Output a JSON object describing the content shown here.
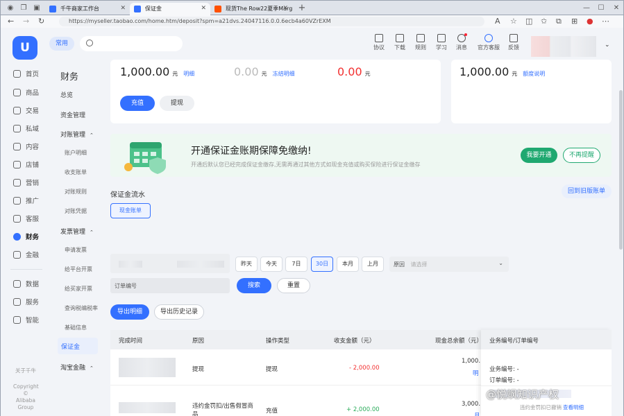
{
  "browser": {
    "tabs": [
      {
        "label": "千牛商家工作台",
        "active": false
      },
      {
        "label": "保证金",
        "active": true
      },
      {
        "label": "现货The Row22夏季Margaux...",
        "active": false
      }
    ],
    "url": "https://myseller.taobao.com/home.htm/deposit?spm=a21dvs.24047116.0.0.6ecb4a60VZrEXM"
  },
  "header": {
    "logo": "U",
    "common": "常用",
    "tools": [
      {
        "label": "协议",
        "icon": "doc-icon"
      },
      {
        "label": "下载",
        "icon": "download-icon"
      },
      {
        "label": "规则",
        "icon": "rule-icon"
      },
      {
        "label": "学习",
        "icon": "learn-icon"
      },
      {
        "label": "消息",
        "icon": "message-icon"
      },
      {
        "label": "官方客服",
        "icon": "service-icon"
      },
      {
        "label": "反馈",
        "icon": "feedback-icon"
      }
    ]
  },
  "sidebar": {
    "items": [
      {
        "label": "首页",
        "icon": "home-icon"
      },
      {
        "label": "商品",
        "icon": "goods-icon"
      },
      {
        "label": "交易",
        "icon": "trade-icon"
      },
      {
        "label": "私域",
        "icon": "private-icon"
      },
      {
        "label": "内容",
        "icon": "content-icon"
      },
      {
        "label": "店铺",
        "icon": "shop-icon"
      },
      {
        "label": "营销",
        "icon": "marketing-icon"
      },
      {
        "label": "推广",
        "icon": "promote-icon"
      },
      {
        "label": "客服",
        "icon": "cs-icon"
      },
      {
        "label": "财务",
        "icon": "finance-icon",
        "active": true
      },
      {
        "label": "金融",
        "icon": "loan-icon"
      }
    ],
    "items2": [
      {
        "label": "数据",
        "icon": "data-icon"
      },
      {
        "label": "服务",
        "icon": "service-grid-icon"
      },
      {
        "label": "智能",
        "icon": "ai-icon"
      }
    ],
    "about": "关于千牛",
    "copyright": "Copyright © Alibaba Group"
  },
  "subnav": {
    "title": "财务",
    "overview": "总览",
    "funds": "资金管理",
    "recon": "对账管理",
    "recon_items": [
      "账户明细",
      "收支账单",
      "对账规则",
      "对账凭据"
    ],
    "invoice": "发票管理",
    "invoice_items": [
      "申请发票",
      "给平台开票",
      "给买家开票",
      "查询税编税率",
      "基础信息"
    ],
    "deposit": "保证金",
    "tb_finance": "淘宝金融"
  },
  "balances": {
    "available": "1,000.00",
    "available_unit": "元",
    "available_link": "明细",
    "frozen": "0.00",
    "frozen_unit": "元",
    "frozen_link": "冻结明细",
    "owed": "0.00",
    "owed_unit": "元",
    "quota": "1,000.00",
    "quota_unit": "元",
    "quota_link": "额度说明"
  },
  "actions": {
    "recharge": "充值",
    "withdraw": "提现"
  },
  "banner": {
    "title": "开通保证金账期保障免缴纳!",
    "desc": "开通后默认您已经完成保证金缴存,无需再通过其他方式如现金充值或购买保险进行保证金缴存",
    "open": "我要开通",
    "dismiss": "不再提醒"
  },
  "flow": {
    "title": "保证金流水",
    "tab": "现金账单",
    "back": "回到旧版账单",
    "ranges": [
      "昨天",
      "今天",
      "7日",
      "30日",
      "本月",
      "上月"
    ],
    "selected_range": "30日",
    "reason_label": "原因",
    "reason_placeholder": "请选择",
    "order_placeholder": "订单编号",
    "search": "搜索",
    "reset": "重置",
    "export": "导出明细",
    "export_history": "导出历史记录"
  },
  "table": {
    "headers": [
      "完成时间",
      "原因",
      "操作类型",
      "收支金额（元）",
      "现金总余额（元）",
      "业务编号/订单编号"
    ],
    "rows": [
      {
        "reason": "提现",
        "type": "提现",
        "amount": "- 2,000.00",
        "balance": "1,000.",
        "balance_link": "明",
        "biz": "业务编号: -",
        "order": "订单编号: -"
      },
      {
        "reason": "违约金罚扣/出售假冒商品",
        "type": "充值",
        "amount": "+ 2,000.00",
        "balance": "3,000.",
        "balance_link": "月",
        "biz_note": "违约金罚扣已撤销",
        "biz_link": "查看明细"
      }
    ]
  },
  "watermark": "@悦飒知识产权",
  "colors": {
    "primary": "#3370ff",
    "danger": "#f23030",
    "green": "#1fa870",
    "positive": "#2bac5b"
  }
}
